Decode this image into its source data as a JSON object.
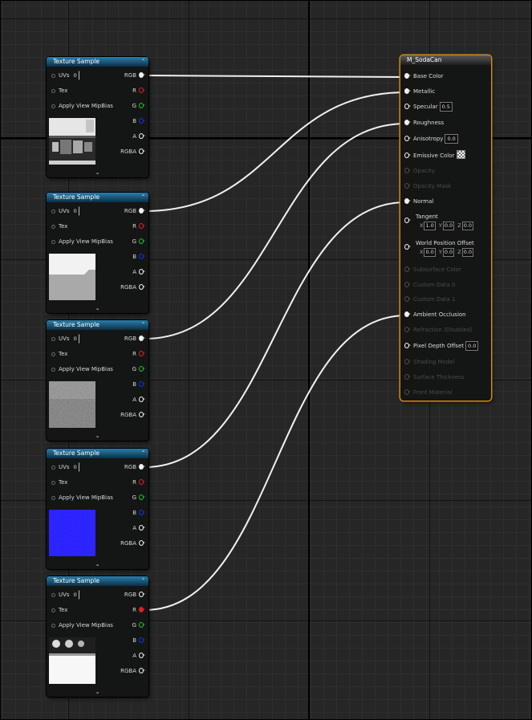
{
  "texture_nodes": [
    {
      "title": "Texture Sample",
      "thumb": "grayscale-mixed",
      "output_connected": "RGB"
    },
    {
      "title": "Texture Sample",
      "thumb": "white-gray-split",
      "output_connected": "RGB"
    },
    {
      "title": "Texture Sample",
      "thumb": "gray-noise",
      "output_connected": "RGB"
    },
    {
      "title": "Texture Sample",
      "thumb": "blue-normal",
      "output_connected": "RGB"
    },
    {
      "title": "Texture Sample",
      "thumb": "white-ao",
      "output_connected": "R"
    }
  ],
  "texture_pins": {
    "uvs_label": "UVs",
    "uvs_value": "0",
    "tex_label": "Tex",
    "mip_label": "Apply View MipBias",
    "rgb": "RGB",
    "r": "R",
    "g": "G",
    "b": "B",
    "a": "A",
    "rgba": "RGBA",
    "expand_glyph": "⌄",
    "collapse_glyph": "⌃"
  },
  "material_node": {
    "title": "M_SodaCan",
    "pins": {
      "base_color": "Base Color",
      "metallic": "Metallic",
      "specular": "Specular",
      "specular_value": "0.5",
      "roughness": "Roughness",
      "anisotropy": "Anisotropy",
      "anisotropy_value": "0.0",
      "emissive_color": "Emissive Color",
      "opacity": "Opacity",
      "opacity_mask": "Opacity Mask",
      "normal": "Normal",
      "tangent": "Tangent",
      "world_position_offset": "World Position Offset",
      "subsurface_color": "Subsurface Color",
      "custom_data_0": "Custom Data 0",
      "custom_data_1": "Custom Data 1",
      "ambient_occlusion": "Ambient Occlusion",
      "refraction": "Refraction (Disabled)",
      "pixel_depth_offset": "Pixel Depth Offset",
      "pixel_depth_offset_value": "0.0",
      "shading_model": "Shading Model",
      "surface_thickness": "Surface Thickness",
      "front_material": "Front Material"
    },
    "tangent_values": {
      "x_label": "X",
      "x": "1.0",
      "y_label": "Y",
      "y": "0.0",
      "z_label": "Z",
      "z": "0.0"
    },
    "wpo_values": {
      "x_label": "X",
      "x": "0.0",
      "y_label": "Y",
      "y": "0.0",
      "z_label": "Z",
      "z": "0.0"
    }
  },
  "connections": [
    {
      "from_node": 0,
      "from_pin": "RGB",
      "to_pin": "Base Color"
    },
    {
      "from_node": 1,
      "from_pin": "RGB",
      "to_pin": "Metallic"
    },
    {
      "from_node": 2,
      "from_pin": "RGB",
      "to_pin": "Roughness"
    },
    {
      "from_node": 3,
      "from_pin": "RGB",
      "to_pin": "Normal"
    },
    {
      "from_node": 4,
      "from_pin": "R",
      "to_pin": "Ambient Occlusion"
    }
  ],
  "colors": {
    "graph_background": "#262626",
    "node_header": "#1f6f9a",
    "material_border": "#d38b12",
    "wire": "#f0f0f0",
    "pin_red": "#e02020",
    "pin_green": "#20c020",
    "pin_blue": "#1c2fe0"
  }
}
